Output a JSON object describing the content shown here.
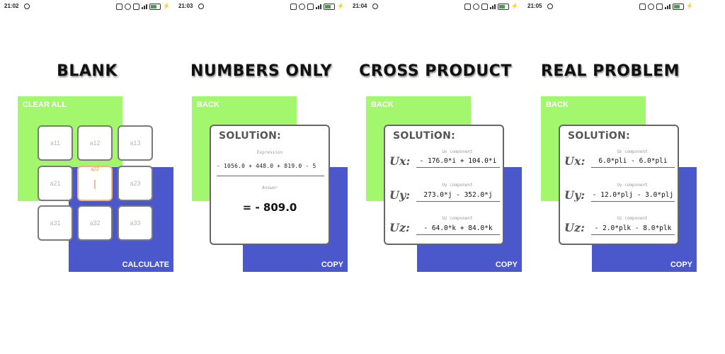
{
  "screens": [
    {
      "status_time": "21:02",
      "title": "BLANK",
      "top_button": "CLEAR ALL",
      "bottom_button": "CALCULATE",
      "cells": [
        "a11",
        "a12",
        "a13",
        "a21",
        "a22",
        "a23",
        "a31",
        "a32",
        "a33"
      ],
      "active_cell_caption": "a22",
      "active_cell_caret": "|"
    },
    {
      "status_time": "21:03",
      "title": "NUMBERS ONLY",
      "top_button": "BACK",
      "bottom_button": "COPY",
      "solution_title": "SOLUTiON:",
      "expression_caption": "Expression",
      "expression": "- 1056.0 + 448.0 + 819.0 - 5",
      "answer_caption": "Answer",
      "answer": "=  - 809.0"
    },
    {
      "status_time": "21:04",
      "title": "CROSS PRODUCT",
      "top_button": "BACK",
      "bottom_button": "COPY",
      "solution_title": "SOLUTiON:",
      "components": [
        {
          "label": "Ux:",
          "caption": "Ux component",
          "value": "- 176.0*i + 104.0*i"
        },
        {
          "label": "Uy:",
          "caption": "Uy component",
          "value": "273.0*j - 352.0*j"
        },
        {
          "label": "Uz:",
          "caption": "Uz component",
          "value": "- 64.0*k + 84.0*k"
        }
      ]
    },
    {
      "status_time": "21:05",
      "title": "REAL PROBLEM",
      "top_button": "BACK",
      "bottom_button": "COPY",
      "solution_title": "SOLUTiON:",
      "components": [
        {
          "label": "Ux:",
          "caption": "Ux component",
          "value": "6.0*pli - 6.0*pli"
        },
        {
          "label": "Uy:",
          "caption": "Uy component",
          "value": "- 12.0*plj - 3.0*plj"
        },
        {
          "label": "Uz:",
          "caption": "Uz component",
          "value": "- 2.0*plk - 8.0*plk"
        }
      ]
    }
  ],
  "colors": {
    "green_panel": "#a3f76c",
    "blue_panel": "#4b58cc",
    "active_cell": "#f0b37e"
  },
  "status_icons": [
    "bluetooth-icon",
    "alarm-icon",
    "nfc-icon",
    "signal-icon",
    "battery-icon",
    "charging-icon"
  ]
}
